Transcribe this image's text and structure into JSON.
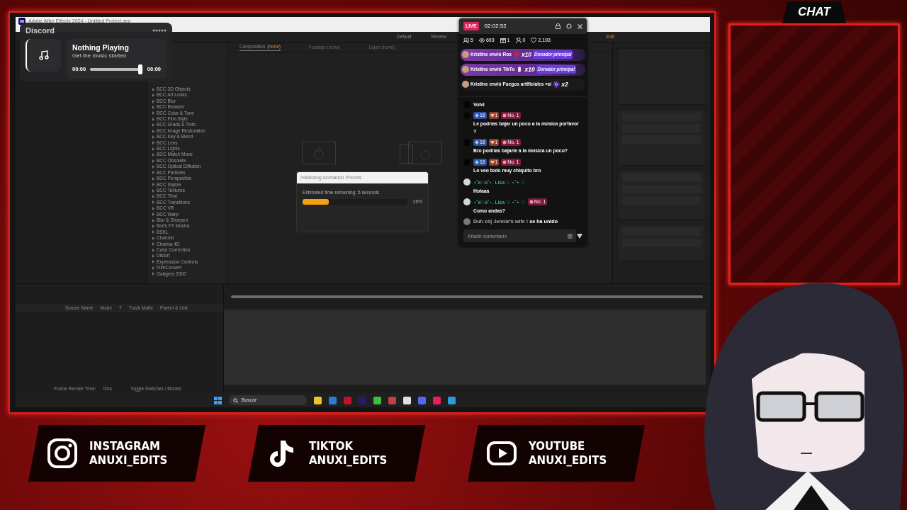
{
  "screen": {
    "app_title": "Adobe After Effects 2024 - Untitled Project.aep",
    "workspaces": [
      {
        "label": "Default",
        "selected": false
      },
      {
        "label": "Review",
        "selected": false
      },
      {
        "label": "Edit",
        "selected": true
      }
    ],
    "viewer_tabs": [
      {
        "label": "Composition",
        "tag": "(none)",
        "selected": true
      },
      {
        "label": "Footage (none)",
        "selected": false
      },
      {
        "label": "Layer (none)",
        "selected": false
      }
    ],
    "effects": [
      {
        "label": "BCC 3D Objects",
        "expanded": false
      },
      {
        "label": "BCC Art Looks",
        "expanded": false
      },
      {
        "label": "BCC Blur",
        "expanded": false
      },
      {
        "label": "BCC Browser",
        "expanded": false
      },
      {
        "label": "BCC Color & Tone",
        "expanded": false
      },
      {
        "label": "BCC Film Style",
        "expanded": false
      },
      {
        "label": "BCC Grads & Tints",
        "expanded": false
      },
      {
        "label": "BCC Image Restoration",
        "expanded": false
      },
      {
        "label": "BCC Key & Blend",
        "expanded": false
      },
      {
        "label": "BCC Lens",
        "expanded": false
      },
      {
        "label": "BCC Lights",
        "expanded": false
      },
      {
        "label": "BCC Match Move",
        "expanded": false
      },
      {
        "label": "BCC Obsolete",
        "expanded": false
      },
      {
        "label": "BCC Optical Diffusion",
        "expanded": false
      },
      {
        "label": "BCC Particles",
        "expanded": false
      },
      {
        "label": "BCC Perspective",
        "expanded": false
      },
      {
        "label": "BCC Stylize",
        "expanded": false
      },
      {
        "label": "BCC Textures",
        "expanded": false
      },
      {
        "label": "BCC Time",
        "expanded": false
      },
      {
        "label": "BCC Transitions",
        "expanded": false
      },
      {
        "label": "BCC VR",
        "expanded": false
      },
      {
        "label": "BCC Warp",
        "expanded": false
      },
      {
        "label": "Blur & Sharpen",
        "expanded": false
      },
      {
        "label": "Boris FX Mocha",
        "expanded": false
      },
      {
        "label": "BSKL",
        "expanded": false
      },
      {
        "label": "Channel",
        "expanded": false
      },
      {
        "label": "Cinema 4D",
        "expanded": false
      },
      {
        "label": "Color Correction",
        "expanded": false
      },
      {
        "label": "Distort",
        "expanded": false
      },
      {
        "label": "Expression Controls",
        "expanded": false
      },
      {
        "label": "FilmConvert",
        "expanded": false
      },
      {
        "label": "Gabgren 2000",
        "expanded": false
      }
    ],
    "loading_dialog": {
      "title": "Initializing Animation Presets",
      "message": "Estimated time remaining: 5 seconds",
      "level": 0.25,
      "percent": "25%"
    },
    "timeline": {
      "columns": [
        "Source Name",
        "Mode",
        "T",
        "Track Matte",
        "Parent & Link"
      ],
      "footer_label": "Frame Render Time:",
      "footer_value": "0ms",
      "toggle_label": "Toggle Switches / Modes"
    },
    "taskbar": {
      "search_label": "Buscar"
    }
  },
  "discord_widget": {
    "title": "Discord",
    "track": "Nothing Playing",
    "subtitle": "Get the music started",
    "elapsed": "00:00",
    "level": 0.95,
    "total": "00:00"
  },
  "live_chat": {
    "live_label": "LIVE",
    "time": "02:02:52",
    "stats": [
      {
        "kind": "viewers",
        "value": "5"
      },
      {
        "kind": "views",
        "value": "693"
      },
      {
        "kind": "gifts",
        "value": "1"
      },
      {
        "kind": "guests",
        "value": "0"
      },
      {
        "kind": "likes",
        "value": "2,193"
      }
    ],
    "gifts": [
      {
        "user": "Kristine",
        "text": "envió Ros",
        "kind": "rose",
        "count": "x10",
        "badge": "Donador principal",
        "highlighted": true
      },
      {
        "user": "Kristine",
        "text": "envió TikTo",
        "kind": "hand",
        "count": "x10",
        "badge": "Donador principal",
        "highlighted": true
      },
      {
        "user": "Kristine",
        "text": "envió Fuegos artificiales «si",
        "kind": "fireworks",
        "count": "x2",
        "highlighted": false
      }
    ],
    "messages": [
      {
        "text": "Volvi"
      },
      {
        "badges": [
          {
            "kind": "level",
            "label": "16"
          },
          {
            "kind": "fan",
            "label": "1"
          },
          {
            "kind": "rank",
            "label": "No. 1"
          }
        ],
        "text": "Le podrías bajar un poco a la música porfavor ?"
      },
      {
        "badges": [
          {
            "kind": "level",
            "label": "16"
          },
          {
            "kind": "fan",
            "label": "1"
          },
          {
            "kind": "rank",
            "label": "No. 1"
          }
        ],
        "text": "Bro podrías bajarle a la música un poco?"
      },
      {
        "badges": [
          {
            "kind": "level",
            "label": "16"
          },
          {
            "kind": "fan",
            "label": "1"
          },
          {
            "kind": "rank",
            "label": "No. 1"
          }
        ],
        "text": "Lo veo todo muy chiquito bro"
      },
      {
        "user": "⋆˚ʚ♡ɞ˚⋆. Lisa ♡ ⋆˚+ ♡",
        "text": "Holaaa"
      },
      {
        "user": "⋆˚ʚ♡ɞ˚⋆. Lisa ♡ ⋆˚+ ♡",
        "badges": [
          {
            "kind": "rank",
            "label": "No. 1"
          }
        ],
        "text": "Como andas?"
      }
    ],
    "join": {
      "user": "Duh cô| Jennie's wife !",
      "action": "se ha unido"
    },
    "placeholder": "Añadir comentario"
  },
  "chat_panel": {
    "title": "CHAT"
  },
  "socials": [
    {
      "kind": "instagram",
      "name": "INSTAGRAM",
      "handle": "ANUXI_EDITS"
    },
    {
      "kind": "tiktok",
      "name": "TIKTOK",
      "handle": "ANUXI_EDITS"
    },
    {
      "kind": "youtube",
      "name": "YOUTUBE",
      "handle": "ANUXI_EDITS"
    }
  ]
}
